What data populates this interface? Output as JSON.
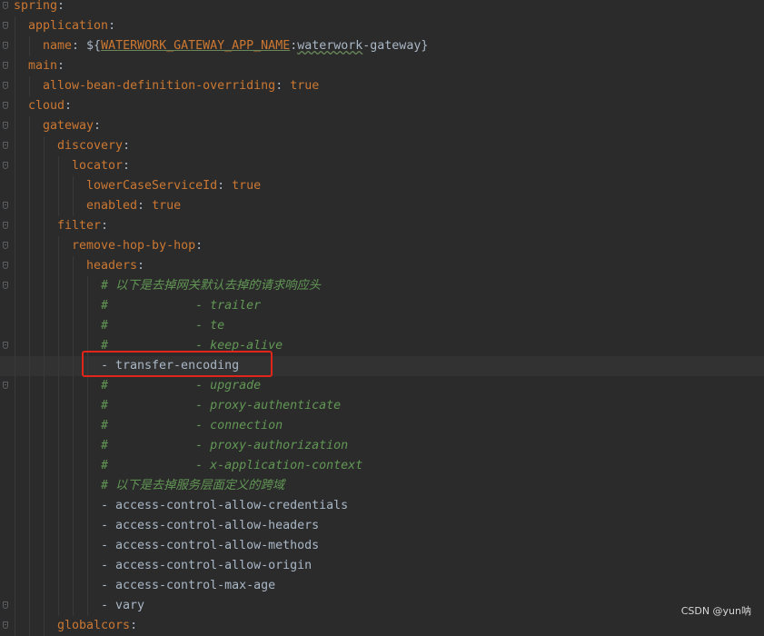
{
  "editor": {
    "lines": [
      {
        "name": "line-spring",
        "fold": true,
        "indent": 0,
        "segments": [
          {
            "t": "spring",
            "c": "key"
          },
          {
            "t": ":",
            "c": "punct"
          }
        ]
      },
      {
        "name": "line-application",
        "fold": true,
        "indent": 1,
        "segments": [
          {
            "t": "application",
            "c": "key"
          },
          {
            "t": ":",
            "c": "punct"
          }
        ]
      },
      {
        "name": "line-name",
        "fold": true,
        "indent": 2,
        "segments": [
          {
            "t": "name",
            "c": "key"
          },
          {
            "t": ": ${",
            "c": "plain"
          },
          {
            "t": "WATERWORK_GATEWAY_APP_NAME",
            "c": "envvar"
          },
          {
            "t": ":",
            "c": "plain"
          },
          {
            "t": "waterwork",
            "c": "wavy"
          },
          {
            "t": "-gateway}",
            "c": "plain"
          }
        ]
      },
      {
        "name": "line-main",
        "fold": true,
        "indent": 1,
        "segments": [
          {
            "t": "main",
            "c": "key"
          },
          {
            "t": ":",
            "c": "punct"
          }
        ]
      },
      {
        "name": "line-allow-bean",
        "fold": true,
        "indent": 2,
        "segments": [
          {
            "t": "allow-bean-definition-overriding",
            "c": "key"
          },
          {
            "t": ": ",
            "c": "punct"
          },
          {
            "t": "true",
            "c": "val"
          }
        ]
      },
      {
        "name": "line-cloud",
        "fold": true,
        "indent": 1,
        "segments": [
          {
            "t": "cloud",
            "c": "key"
          },
          {
            "t": ":",
            "c": "punct"
          }
        ]
      },
      {
        "name": "line-gateway",
        "fold": true,
        "indent": 2,
        "segments": [
          {
            "t": "gateway",
            "c": "key"
          },
          {
            "t": ":",
            "c": "punct"
          }
        ]
      },
      {
        "name": "line-discovery",
        "fold": true,
        "indent": 3,
        "segments": [
          {
            "t": "discovery",
            "c": "key"
          },
          {
            "t": ":",
            "c": "punct"
          }
        ]
      },
      {
        "name": "line-locator",
        "fold": true,
        "indent": 4,
        "segments": [
          {
            "t": "locator",
            "c": "key"
          },
          {
            "t": ":",
            "c": "punct"
          }
        ]
      },
      {
        "name": "line-lowercase",
        "fold": false,
        "indent": 5,
        "segments": [
          {
            "t": "lowerCaseServiceId",
            "c": "key"
          },
          {
            "t": ": ",
            "c": "punct"
          },
          {
            "t": "true",
            "c": "val"
          }
        ]
      },
      {
        "name": "line-enabled",
        "fold": true,
        "indent": 5,
        "segments": [
          {
            "t": "enabled",
            "c": "key"
          },
          {
            "t": ": ",
            "c": "punct"
          },
          {
            "t": "true",
            "c": "val"
          }
        ]
      },
      {
        "name": "line-filter",
        "fold": true,
        "indent": 3,
        "segments": [
          {
            "t": "filter",
            "c": "key"
          },
          {
            "t": ":",
            "c": "punct"
          }
        ]
      },
      {
        "name": "line-remove-hop",
        "fold": true,
        "indent": 4,
        "segments": [
          {
            "t": "remove-hop-by-hop",
            "c": "key"
          },
          {
            "t": ":",
            "c": "punct"
          }
        ]
      },
      {
        "name": "line-headers",
        "fold": true,
        "indent": 5,
        "segments": [
          {
            "t": "headers",
            "c": "key"
          },
          {
            "t": ":",
            "c": "punct"
          }
        ]
      },
      {
        "name": "line-comment-1",
        "fold": true,
        "indent": 6,
        "segments": [
          {
            "t": "# 以下是去掉网关默认去掉的请求响应头",
            "c": "comment"
          }
        ]
      },
      {
        "name": "line-comment-trailer",
        "fold": false,
        "indent": 6,
        "segments": [
          {
            "t": "#            - trailer",
            "c": "comment"
          }
        ]
      },
      {
        "name": "line-comment-te",
        "fold": false,
        "indent": 6,
        "segments": [
          {
            "t": "#            - te",
            "c": "comment"
          }
        ]
      },
      {
        "name": "line-comment-keepalive",
        "fold": true,
        "indent": 6,
        "segments": [
          {
            "t": "#            - keep-alive",
            "c": "comment"
          }
        ]
      },
      {
        "name": "line-transfer-encoding",
        "fold": false,
        "indent": 6,
        "current": true,
        "segments": [
          {
            "t": "- transfer-encoding",
            "c": "plain"
          }
        ]
      },
      {
        "name": "line-comment-upgrade",
        "fold": true,
        "indent": 6,
        "segments": [
          {
            "t": "#            - upgrade",
            "c": "comment"
          }
        ]
      },
      {
        "name": "line-comment-proxy-auth",
        "fold": false,
        "indent": 6,
        "segments": [
          {
            "t": "#            - proxy-authenticate",
            "c": "comment"
          }
        ]
      },
      {
        "name": "line-comment-connection",
        "fold": false,
        "indent": 6,
        "segments": [
          {
            "t": "#            - connection",
            "c": "comment"
          }
        ]
      },
      {
        "name": "line-comment-proxy-authz",
        "fold": false,
        "indent": 6,
        "segments": [
          {
            "t": "#            - proxy-authorization",
            "c": "comment"
          }
        ]
      },
      {
        "name": "line-comment-x-app",
        "fold": false,
        "indent": 6,
        "segments": [
          {
            "t": "#            - x-application-context",
            "c": "comment"
          }
        ]
      },
      {
        "name": "line-comment-2",
        "fold": false,
        "indent": 6,
        "segments": [
          {
            "t": "# 以下是去掉服务层面定义的跨域",
            "c": "comment"
          }
        ]
      },
      {
        "name": "line-acac",
        "fold": false,
        "indent": 6,
        "segments": [
          {
            "t": "- access-control-allow-credentials",
            "c": "plain"
          }
        ]
      },
      {
        "name": "line-acah",
        "fold": false,
        "indent": 6,
        "segments": [
          {
            "t": "- access-control-allow-headers",
            "c": "plain"
          }
        ]
      },
      {
        "name": "line-acam",
        "fold": false,
        "indent": 6,
        "segments": [
          {
            "t": "- access-control-allow-methods",
            "c": "plain"
          }
        ]
      },
      {
        "name": "line-acao",
        "fold": false,
        "indent": 6,
        "segments": [
          {
            "t": "- access-control-allow-origin",
            "c": "plain"
          }
        ]
      },
      {
        "name": "line-acma",
        "fold": false,
        "indent": 6,
        "segments": [
          {
            "t": "- access-control-max-age",
            "c": "plain"
          }
        ]
      },
      {
        "name": "line-vary",
        "fold": true,
        "indent": 6,
        "segments": [
          {
            "t": "- vary",
            "c": "plain"
          }
        ]
      },
      {
        "name": "line-globalcors",
        "fold": true,
        "indent": 3,
        "segments": [
          {
            "t": "globalcors",
            "c": "key"
          },
          {
            "t": ":",
            "c": "punct"
          }
        ]
      }
    ]
  },
  "watermark": "CSDN @yun呐"
}
